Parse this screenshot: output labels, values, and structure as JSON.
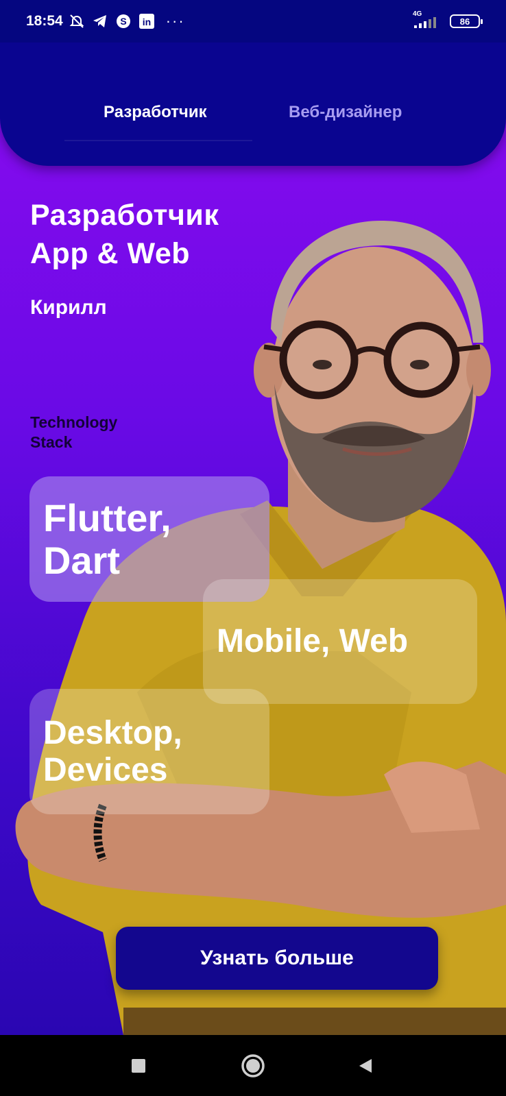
{
  "status_bar": {
    "time": "18:54",
    "network": "4G",
    "battery": "86",
    "icons": [
      "mute-icon",
      "telegram-icon",
      "skype-icon",
      "linkedin-icon",
      "more-icon"
    ]
  },
  "tabs": [
    {
      "label": "Разработчик",
      "active": true
    },
    {
      "label": "Веб-дизайнер",
      "active": false
    }
  ],
  "hero": {
    "title_line1": "Разработчик",
    "title_line2": "App & Web",
    "name": "Кирилл",
    "stack_label_line1": "Technology",
    "stack_label_line2": "Stack"
  },
  "chips": [
    {
      "line1": "Flutter,",
      "line2": "Dart"
    },
    {
      "line1": "Mobile, Web"
    },
    {
      "line1": "Desktop,",
      "line2": "Devices"
    }
  ],
  "cta": {
    "label": "Узнать больше"
  },
  "colors": {
    "status_bar": "#050680",
    "tab_header": "#0a0590",
    "gradient_top": "#8e0cf0",
    "gradient_bottom": "#2a06b2",
    "cta": "#13078e",
    "shirt": "#c9a21f"
  },
  "nav_bar": [
    "recent-apps-icon",
    "home-icon",
    "back-icon"
  ]
}
